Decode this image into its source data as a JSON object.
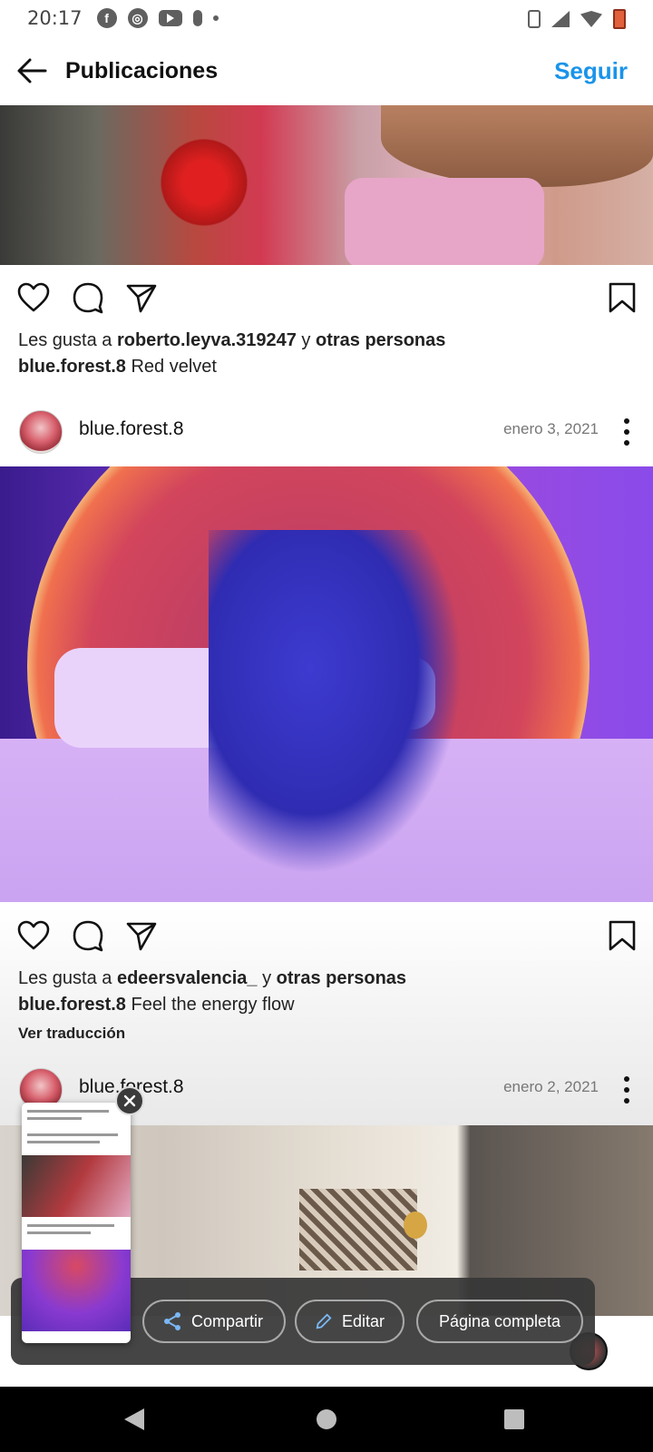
{
  "status_bar": {
    "time": "20:17",
    "left_icons": [
      "facebook-icon",
      "chrome-icon",
      "youtube-icon",
      "mic-icon",
      "dot-icon"
    ],
    "right_icons": [
      "vibrate-icon",
      "signal-icon",
      "wifi-icon",
      "battery-icon"
    ]
  },
  "header": {
    "title": "Publicaciones",
    "follow_label": "Seguir",
    "accent_color": "#1a94ea"
  },
  "posts": [
    {
      "likes_prefix": "Les gusta a ",
      "liked_by": "roberto.leyva.319247",
      "likes_mid": " y ",
      "likes_others": "otras personas",
      "caption_user": "blue.forest.8",
      "caption_text": " Red velvet"
    },
    {
      "username": "blue.forest.8",
      "date": "enero 3, 2021",
      "likes_prefix": "Les gusta a ",
      "liked_by": "edeersvalencia_",
      "likes_mid": " y ",
      "likes_others": "otras personas",
      "caption_user": "blue.forest.8",
      "caption_text": " Feel the energy flow",
      "translate": "Ver traducción"
    },
    {
      "username": "blue.forest.8",
      "date": "enero 2, 2021"
    }
  ],
  "share_panel": {
    "share_label": "Compartir",
    "edit_label": "Editar",
    "full_page_label": "Página completa"
  }
}
